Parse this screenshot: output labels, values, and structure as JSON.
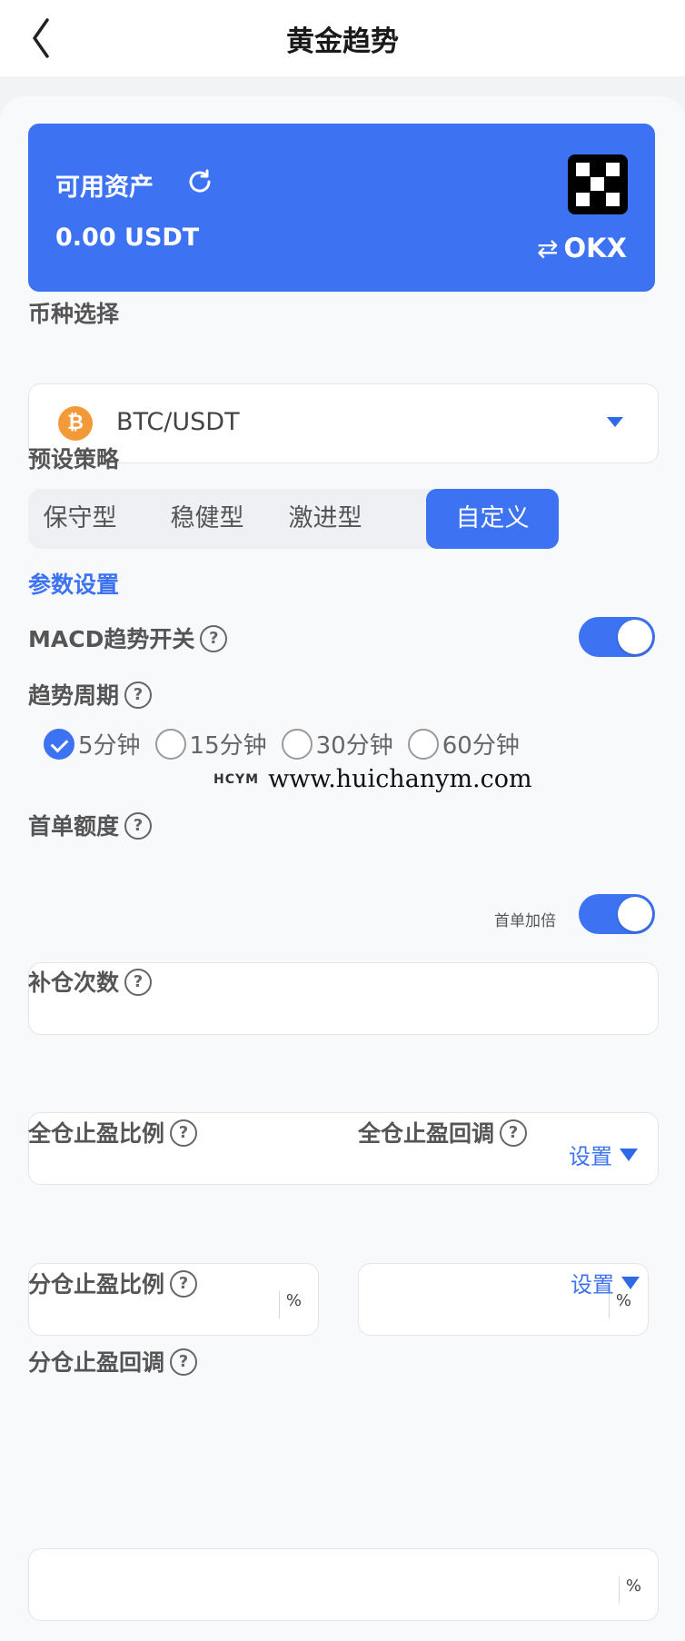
{
  "header": {
    "title": "黄金趋势"
  },
  "asset_card": {
    "label": "可用资产",
    "value": "0.00 USDT",
    "exchange": "OKX",
    "swap_icon": "⇄",
    "background": "#3d73f2"
  },
  "coin": {
    "label": "币种选择",
    "selected": "BTC/USDT",
    "icon": "bitcoin-icon",
    "icon_glyph": "₿"
  },
  "strategy": {
    "label": "预设策略",
    "tabs": [
      "保守型",
      "稳健型",
      "激进型",
      "自定义"
    ],
    "active": "自定义"
  },
  "params": {
    "title": "参数设置",
    "macd_switch": {
      "label": "MACD趋势开关",
      "on": true
    },
    "period": {
      "label": "趋势周期",
      "options": [
        "5分钟",
        "15分钟",
        "30分钟",
        "60分钟"
      ],
      "selected": "5分钟"
    },
    "first_order": {
      "label": "首单额度",
      "double_label": "首单加倍",
      "double_on": true,
      "value": ""
    },
    "add_times": {
      "label": "补仓次数",
      "set_label": "设置",
      "value": ""
    },
    "full_tp_ratio": {
      "label": "全仓止盈比例",
      "unit": "%",
      "value": ""
    },
    "full_tp_pullback": {
      "label": "全仓止盈回调",
      "unit": "%",
      "value": ""
    },
    "part_tp_ratio": {
      "label": "分仓止盈比例",
      "set_label": "设置"
    },
    "part_tp_pullback": {
      "label": "分仓止盈回调",
      "unit": "%",
      "value": ""
    }
  },
  "watermark": {
    "logo": "HCYM",
    "url": "www.huichanym.com"
  },
  "help_glyph": "?",
  "accent": "#3d73f2"
}
